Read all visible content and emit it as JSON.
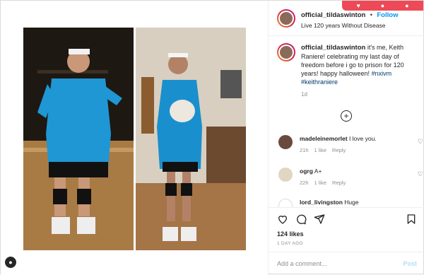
{
  "post": {
    "username": "official_tildaswinton",
    "follow_label": "Follow",
    "location": "Live 120 years Without Disease",
    "caption_text": " it's me, Keith Raniere! celebrating my last day of freedom before i go to prison for 120 years! happy halloween! ",
    "hashtags": "#nxivm #keithraniere",
    "caption_time": "1d",
    "likes": "124 likes",
    "posted_ago": "1 DAY AGO",
    "add_comment_placeholder": "Add a comment...",
    "post_label": "Post"
  },
  "comments": [
    {
      "user": "madeleinemorlet",
      "text": "I love you.",
      "time": "21h",
      "likes": "1 like",
      "reply": "Reply"
    },
    {
      "user": "ogrg",
      "text": "A+",
      "time": "22h",
      "likes": "1 like",
      "reply": "Reply"
    },
    {
      "user": "lord_livingston",
      "text": "Huge",
      "time": "",
      "likes": "",
      "reply": ""
    }
  ],
  "colors": {
    "accent": "#0095f6",
    "post_disabled": "#b2dffc",
    "notify": "#ed4956"
  },
  "icons": [
    "heart-icon",
    "comment-icon",
    "share-icon",
    "bookmark-icon",
    "add-comment-plus-icon",
    "like-comment-heart-icon"
  ]
}
